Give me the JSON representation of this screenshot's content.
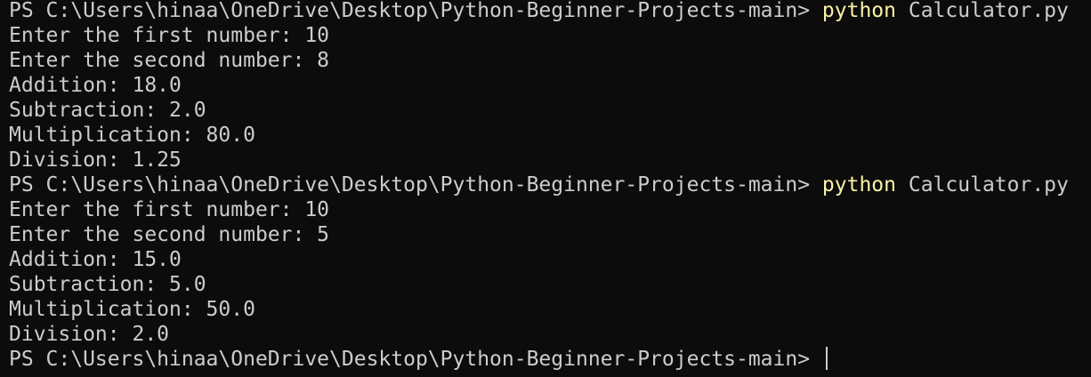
{
  "terminal": {
    "prompt": "PS C:\\Users\\hinaa\\OneDrive\\Desktop\\Python-Beginner-Projects-main> ",
    "command_colors": {
      "default_text": "#cccccc",
      "command_highlight": "#f9f1a5",
      "background": "#0c0c0c"
    },
    "runs": [
      {
        "command_program": "python",
        "command_args": " Calculator.py",
        "output": [
          "Enter the first number: 10",
          "Enter the second number: 8",
          "Addition: 18.0",
          "Subtraction: 2.0",
          "Multiplication: 80.0",
          "Division: 1.25"
        ]
      },
      {
        "command_program": "python",
        "command_args": " Calculator.py",
        "output": [
          "Enter the first number: 10",
          "Enter the second number: 5",
          "Addition: 15.0",
          "Subtraction: 5.0",
          "Multiplication: 50.0",
          "Division: 2.0"
        ]
      }
    ],
    "final_prompt": "PS C:\\Users\\hinaa\\OneDrive\\Desktop\\Python-Beginner-Projects-main> "
  }
}
